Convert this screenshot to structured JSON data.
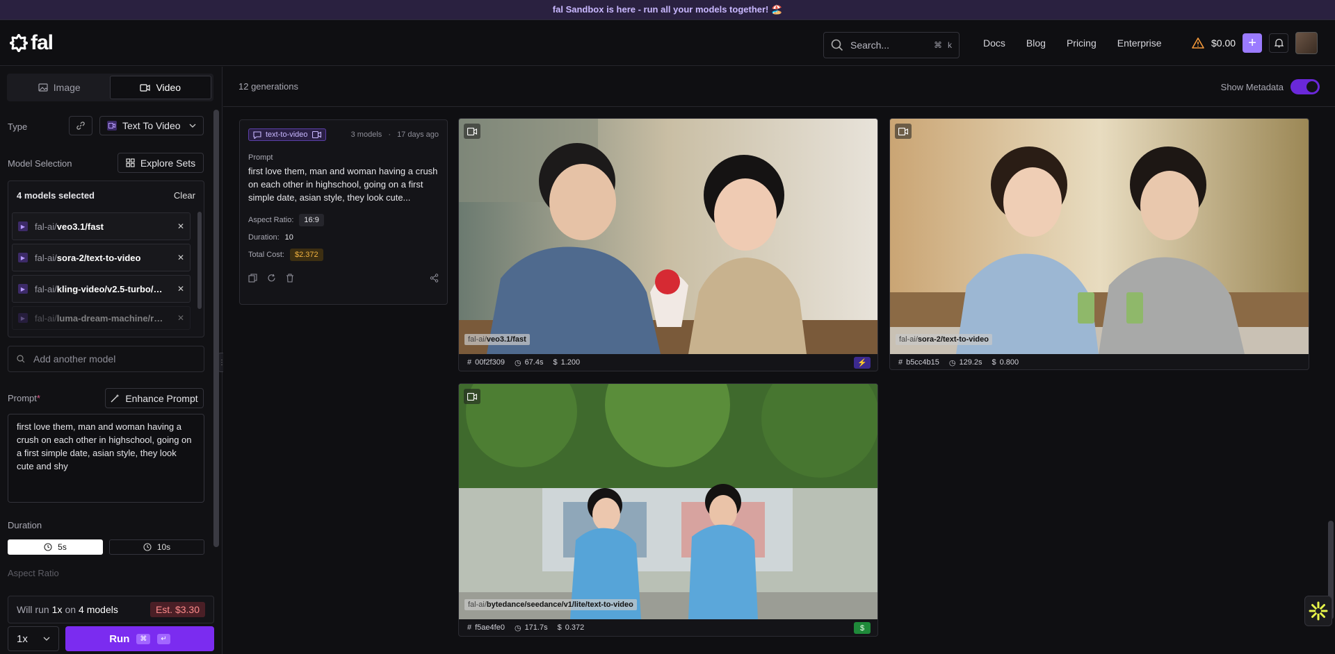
{
  "banner": {
    "text": "fal Sandbox is here - run all your models together! 🏖️"
  },
  "header": {
    "logo": "fal",
    "search_placeholder": "Search...",
    "search_shortcut": [
      "⌘",
      "k"
    ],
    "nav": [
      "Docs",
      "Blog",
      "Pricing",
      "Enterprise"
    ],
    "balance": "$0.00"
  },
  "sidebar": {
    "tabs": [
      "Image",
      "Video"
    ],
    "active_tab": "Video",
    "type_label": "Type",
    "type_value": "Text To Video",
    "model_selection_label": "Model Selection",
    "explore_sets": "Explore Sets",
    "models_selected": "4 models selected",
    "clear": "Clear",
    "models": [
      {
        "prefix": "fal-ai/",
        "name": "veo3.1/fast"
      },
      {
        "prefix": "fal-ai/",
        "name": "sora-2/text-to-video"
      },
      {
        "prefix": "fal-ai/",
        "name": "kling-video/v2.5-turbo/…"
      },
      {
        "prefix": "fal-ai/",
        "name": "luma-dream-machine/r…"
      }
    ],
    "add_model_placeholder": "Add another model",
    "prompt_label": "Prompt",
    "prompt_required": "*",
    "enhance_prompt": "Enhance Prompt",
    "prompt_value": "first love them, man and woman having a crush on each other in highschool, going on a first simple date, asian style, they look cute and shy",
    "duration_label": "Duration",
    "durations": [
      "5s",
      "10s"
    ],
    "selected_duration": "5s",
    "aspect_ratio_label": "Aspect Ratio",
    "run_summary": {
      "prefix": "Will run",
      "mult": "1x",
      "mid": "on",
      "models": "4 models"
    },
    "estimate": "Est. $3.30",
    "multiplier": "1x",
    "run_label": "Run",
    "run_keys": [
      "⌘",
      "↵"
    ]
  },
  "main": {
    "generations_count": "12 generations",
    "show_metadata_label": "Show Metadata",
    "show_metadata": true,
    "meta": {
      "chip": "text-to-video",
      "models": "3 models",
      "age": "17 days ago",
      "prompt_label": "Prompt",
      "prompt": "first love them, man and woman having a crush on each other in highschool, going on a first simple date, asian style, they look cute...",
      "aspect_label": "Aspect Ratio:",
      "aspect_value": "16:9",
      "duration_label": "Duration:",
      "duration_value": "10",
      "cost_label": "Total Cost:",
      "cost_value": "$2.372"
    },
    "results": [
      {
        "prefix": "fal-ai/",
        "model": "veo3.1/fast",
        "id": "00f2f309",
        "time": "67.4s",
        "cost": "1.200",
        "badge": "⚡",
        "badge_color": "#5b3fd0"
      },
      {
        "prefix": "fal-ai/",
        "model": "sora-2/text-to-video",
        "id": "b5cc4b15",
        "time": "129.2s",
        "cost": "0.800"
      },
      {
        "prefix": "fal-ai/",
        "model": "bytedance/seedance/v1/lite/text-to-video",
        "id": "f5ae4fe0",
        "time": "171.7s",
        "cost": "0.372",
        "badge": "$",
        "badge_color": "#1f8a3a"
      }
    ]
  }
}
